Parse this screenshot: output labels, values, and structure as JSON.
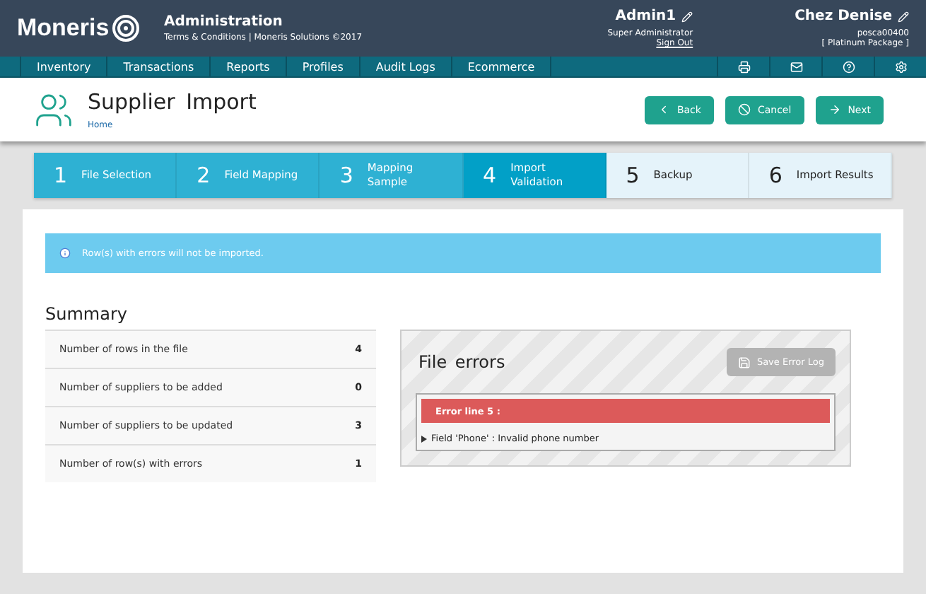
{
  "header": {
    "logo": "Moneris",
    "section": "Administration",
    "links": "Terms & Conditions | Moneris Solutions ©2017",
    "user": {
      "name": "Admin1",
      "role": "Super Administrator",
      "sign_out": "Sign Out"
    },
    "store": {
      "name": "Chez Denise",
      "id": "posca00400",
      "package": "[ Platinum Package ]"
    }
  },
  "nav": {
    "items": [
      "Inventory",
      "Transactions",
      "Reports",
      "Profiles",
      "Audit Logs",
      "Ecommerce"
    ]
  },
  "page": {
    "title": "Supplier Import",
    "breadcrumb": "Home",
    "buttons": [
      {
        "kind": "back",
        "label": "Back"
      },
      {
        "kind": "cancel",
        "label": "Cancel"
      },
      {
        "kind": "next",
        "label": "Next"
      }
    ]
  },
  "steps": [
    {
      "number": "1",
      "label": "File Selection",
      "completed": true,
      "selected": false
    },
    {
      "number": "2",
      "label": "Field Mapping",
      "completed": true,
      "selected": false
    },
    {
      "number": "3",
      "label": "Mapping Sample",
      "completed": true,
      "selected": false
    },
    {
      "number": "4",
      "label": "Import Validation",
      "completed": true,
      "selected": true
    },
    {
      "number": "5",
      "label": "Backup",
      "completed": false,
      "selected": false
    },
    {
      "number": "6",
      "label": "Import Results",
      "completed": false,
      "selected": false
    }
  ],
  "alert": "Row(s) with errors will not be imported.",
  "summary": {
    "title": "Summary",
    "rows": [
      {
        "label": "Number of rows in the file",
        "value": "4"
      },
      {
        "label": "Number of suppliers to be added",
        "value": "0"
      },
      {
        "label": "Number of suppliers to be updated",
        "value": "3"
      },
      {
        "label": "Number of row(s) with errors",
        "value": "1"
      }
    ]
  },
  "file_errors": {
    "title": "File errors",
    "save_button": "Save Error Log",
    "errors": [
      {
        "heading": "Error line 5 :",
        "details": [
          "Field 'Phone' : Invalid phone number"
        ]
      }
    ]
  }
}
